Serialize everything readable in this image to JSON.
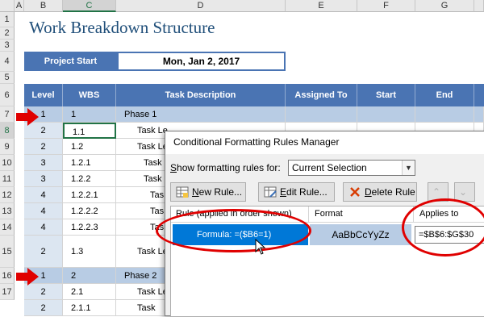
{
  "columns": [
    "A",
    "B",
    "C",
    "D",
    "E",
    "F",
    "G"
  ],
  "selected_column": "C",
  "rows": [
    "1",
    "2",
    "3",
    "4",
    "5",
    "6",
    "7",
    "8",
    "9",
    "10",
    "11",
    "12",
    "13",
    "14",
    "15",
    "16",
    "17"
  ],
  "selected_row": "8",
  "title": "Work Breakdown Structure",
  "project_start": {
    "label": "Project Start",
    "value": "Mon, Jan 2, 2017"
  },
  "headers": [
    "Level",
    "WBS",
    "Task Description",
    "Assigned To",
    "Start",
    "End"
  ],
  "data_rows": [
    {
      "level": "1",
      "wbs": "1",
      "task": "Phase 1",
      "phase": true
    },
    {
      "level": "2",
      "wbs": "1.1",
      "task": "Task Le",
      "phase": false
    },
    {
      "level": "2",
      "wbs": "1.2",
      "task": "Task Le",
      "phase": false
    },
    {
      "level": "3",
      "wbs": "1.2.1",
      "task": "Task",
      "phase": false
    },
    {
      "level": "3",
      "wbs": "1.2.2",
      "task": "Task",
      "phase": false
    },
    {
      "level": "4",
      "wbs": "1.2.2.1",
      "task": "Tas",
      "phase": false
    },
    {
      "level": "4",
      "wbs": "1.2.2.2",
      "task": "Tas",
      "phase": false
    },
    {
      "level": "4",
      "wbs": "1.2.2.3",
      "task": "Tas",
      "phase": false
    },
    {
      "level": "2",
      "wbs": "1.3",
      "task": "Task Le",
      "phase": false
    },
    {
      "level": "1",
      "wbs": "2",
      "task": "Phase 2",
      "phase": true
    },
    {
      "level": "2",
      "wbs": "2.1",
      "task": "Task Le",
      "phase": false
    },
    {
      "level": "2",
      "wbs": "2.1.1",
      "task": "Task",
      "phase": false
    }
  ],
  "dialog": {
    "title": "Conditional Formatting Rules Manager",
    "show_label": "Show formatting rules for:",
    "show_value": "Current Selection",
    "new_rule": "New Rule...",
    "edit_rule": "Edit Rule...",
    "delete_rule": "Delete Rule",
    "col_rule": "Rule (applied in order shown)",
    "col_format": "Format",
    "col_applies": "Applies to",
    "rule_formula": "Formula: =($B6=1)",
    "format_preview": "AaBbCcYyZz",
    "applies_to": "=$B$6:$G$30"
  },
  "colors": {
    "header_blue": "#4a74b3",
    "phase_blue": "#b8cce4",
    "title_blue": "#1f4e79",
    "highlight_red": "#e00000",
    "rule_selected": "#0078d7"
  }
}
